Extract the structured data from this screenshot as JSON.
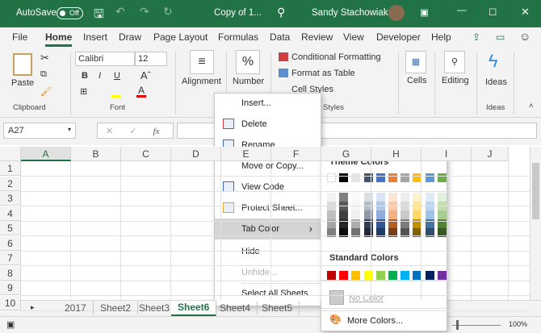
{
  "titlebar": {
    "autosave": "AutoSave",
    "toggle": "Off",
    "doc": "Copy of 1...",
    "user": "Sandy Stachowiak"
  },
  "menu": [
    "File",
    "Home",
    "Insert",
    "Draw",
    "Page Layout",
    "Formulas",
    "Data",
    "Review",
    "View",
    "Developer",
    "Help"
  ],
  "ribbon": {
    "paste": "Paste",
    "font": "Calibri",
    "size": "12",
    "bold": "B",
    "italic": "I",
    "underline": "U",
    "alignment": "Alignment",
    "number": "Number",
    "number_icon": "%",
    "cond": "Conditional Formatting",
    "fmt_table": "Format as Table",
    "cell_styles": "Cell Styles",
    "cells": "Cells",
    "editing": "Editing",
    "ideas": "Ideas",
    "groups": {
      "clipboard": "Clipboard",
      "font": "Font",
      "styles": "Styles",
      "ideas": "Ideas"
    }
  },
  "formula": {
    "namebox": "A27",
    "cancel": "✕",
    "enter": "✓",
    "fx": "fx",
    "value": ""
  },
  "columns": [
    "A",
    "B",
    "C",
    "D",
    "E",
    "F",
    "G",
    "H",
    "I",
    "J"
  ],
  "rows": [
    "1",
    "2",
    "3",
    "4",
    "5",
    "6",
    "7",
    "8",
    "9",
    "10"
  ],
  "sheets": [
    "2017",
    "Sheet2",
    "Sheet3",
    "Sheet6",
    "Sheet4",
    "Sheet5"
  ],
  "active_sheet": "Sheet6",
  "status": {
    "zoom": "100%"
  },
  "context_menu": [
    {
      "label": "Insert...",
      "icon": null
    },
    {
      "label": "Delete",
      "icon": "delete-sheet-icon"
    },
    {
      "label": "Rename",
      "icon": "rename-icon"
    },
    {
      "label": "Move or Copy...",
      "icon": null
    },
    {
      "label": "View Code",
      "icon": "view-code-icon"
    },
    {
      "label": "Protect Sheet...",
      "icon": "protect-sheet-icon"
    },
    {
      "label": "Tab Color",
      "icon": null,
      "submenu": true
    },
    {
      "label": "Hide",
      "icon": null
    },
    {
      "label": "Unhide...",
      "icon": null,
      "disabled": true
    },
    {
      "label": "Select All Sheets",
      "icon": null
    }
  ],
  "tab_color": {
    "theme_title": "Theme Colors",
    "standard_title": "Standard Colors",
    "no_color": "No Color",
    "more_colors": "More Colors...",
    "theme": [
      "#ffffff",
      "#000000",
      "#e7e6e6",
      "#44546a",
      "#4472c4",
      "#ed7d31",
      "#a5a5a5",
      "#ffc000",
      "#5b9bd5",
      "#70ad47"
    ],
    "standard": [
      "#c00000",
      "#ff0000",
      "#ffc000",
      "#ffff00",
      "#92d050",
      "#00b050",
      "#00b0f0",
      "#0070c0",
      "#002060",
      "#7030a0"
    ]
  },
  "colors": {
    "brand": "#217346"
  }
}
